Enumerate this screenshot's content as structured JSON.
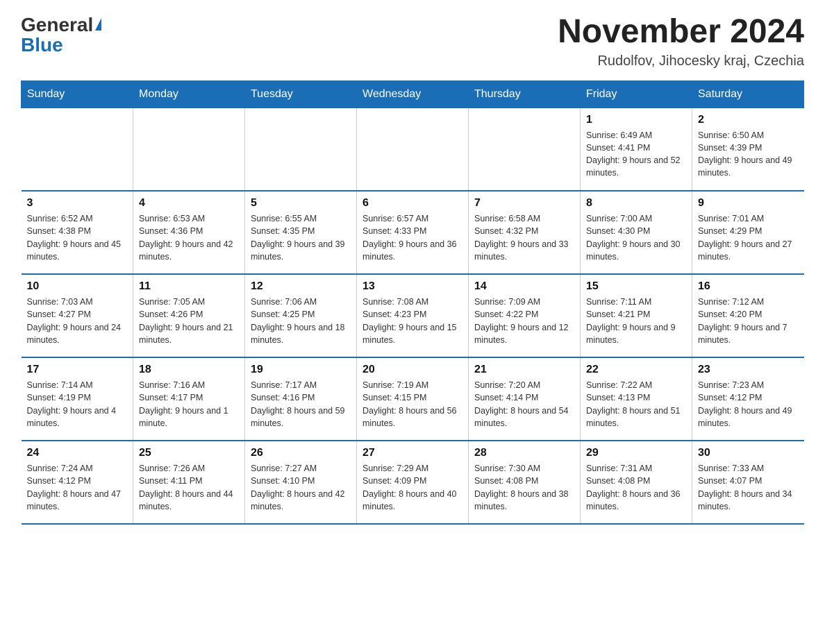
{
  "header": {
    "logo_text_general": "General",
    "logo_text_blue": "Blue",
    "month_title": "November 2024",
    "location": "Rudolfov, Jihocesky kraj, Czechia"
  },
  "days_of_week": [
    "Sunday",
    "Monday",
    "Tuesday",
    "Wednesday",
    "Thursday",
    "Friday",
    "Saturday"
  ],
  "weeks": [
    {
      "days": [
        {
          "number": "",
          "sunrise": "",
          "sunset": "",
          "daylight": ""
        },
        {
          "number": "",
          "sunrise": "",
          "sunset": "",
          "daylight": ""
        },
        {
          "number": "",
          "sunrise": "",
          "sunset": "",
          "daylight": ""
        },
        {
          "number": "",
          "sunrise": "",
          "sunset": "",
          "daylight": ""
        },
        {
          "number": "",
          "sunrise": "",
          "sunset": "",
          "daylight": ""
        },
        {
          "number": "1",
          "sunrise": "Sunrise: 6:49 AM",
          "sunset": "Sunset: 4:41 PM",
          "daylight": "Daylight: 9 hours and 52 minutes."
        },
        {
          "number": "2",
          "sunrise": "Sunrise: 6:50 AM",
          "sunset": "Sunset: 4:39 PM",
          "daylight": "Daylight: 9 hours and 49 minutes."
        }
      ]
    },
    {
      "days": [
        {
          "number": "3",
          "sunrise": "Sunrise: 6:52 AM",
          "sunset": "Sunset: 4:38 PM",
          "daylight": "Daylight: 9 hours and 45 minutes."
        },
        {
          "number": "4",
          "sunrise": "Sunrise: 6:53 AM",
          "sunset": "Sunset: 4:36 PM",
          "daylight": "Daylight: 9 hours and 42 minutes."
        },
        {
          "number": "5",
          "sunrise": "Sunrise: 6:55 AM",
          "sunset": "Sunset: 4:35 PM",
          "daylight": "Daylight: 9 hours and 39 minutes."
        },
        {
          "number": "6",
          "sunrise": "Sunrise: 6:57 AM",
          "sunset": "Sunset: 4:33 PM",
          "daylight": "Daylight: 9 hours and 36 minutes."
        },
        {
          "number": "7",
          "sunrise": "Sunrise: 6:58 AM",
          "sunset": "Sunset: 4:32 PM",
          "daylight": "Daylight: 9 hours and 33 minutes."
        },
        {
          "number": "8",
          "sunrise": "Sunrise: 7:00 AM",
          "sunset": "Sunset: 4:30 PM",
          "daylight": "Daylight: 9 hours and 30 minutes."
        },
        {
          "number": "9",
          "sunrise": "Sunrise: 7:01 AM",
          "sunset": "Sunset: 4:29 PM",
          "daylight": "Daylight: 9 hours and 27 minutes."
        }
      ]
    },
    {
      "days": [
        {
          "number": "10",
          "sunrise": "Sunrise: 7:03 AM",
          "sunset": "Sunset: 4:27 PM",
          "daylight": "Daylight: 9 hours and 24 minutes."
        },
        {
          "number": "11",
          "sunrise": "Sunrise: 7:05 AM",
          "sunset": "Sunset: 4:26 PM",
          "daylight": "Daylight: 9 hours and 21 minutes."
        },
        {
          "number": "12",
          "sunrise": "Sunrise: 7:06 AM",
          "sunset": "Sunset: 4:25 PM",
          "daylight": "Daylight: 9 hours and 18 minutes."
        },
        {
          "number": "13",
          "sunrise": "Sunrise: 7:08 AM",
          "sunset": "Sunset: 4:23 PM",
          "daylight": "Daylight: 9 hours and 15 minutes."
        },
        {
          "number": "14",
          "sunrise": "Sunrise: 7:09 AM",
          "sunset": "Sunset: 4:22 PM",
          "daylight": "Daylight: 9 hours and 12 minutes."
        },
        {
          "number": "15",
          "sunrise": "Sunrise: 7:11 AM",
          "sunset": "Sunset: 4:21 PM",
          "daylight": "Daylight: 9 hours and 9 minutes."
        },
        {
          "number": "16",
          "sunrise": "Sunrise: 7:12 AM",
          "sunset": "Sunset: 4:20 PM",
          "daylight": "Daylight: 9 hours and 7 minutes."
        }
      ]
    },
    {
      "days": [
        {
          "number": "17",
          "sunrise": "Sunrise: 7:14 AM",
          "sunset": "Sunset: 4:19 PM",
          "daylight": "Daylight: 9 hours and 4 minutes."
        },
        {
          "number": "18",
          "sunrise": "Sunrise: 7:16 AM",
          "sunset": "Sunset: 4:17 PM",
          "daylight": "Daylight: 9 hours and 1 minute."
        },
        {
          "number": "19",
          "sunrise": "Sunrise: 7:17 AM",
          "sunset": "Sunset: 4:16 PM",
          "daylight": "Daylight: 8 hours and 59 minutes."
        },
        {
          "number": "20",
          "sunrise": "Sunrise: 7:19 AM",
          "sunset": "Sunset: 4:15 PM",
          "daylight": "Daylight: 8 hours and 56 minutes."
        },
        {
          "number": "21",
          "sunrise": "Sunrise: 7:20 AM",
          "sunset": "Sunset: 4:14 PM",
          "daylight": "Daylight: 8 hours and 54 minutes."
        },
        {
          "number": "22",
          "sunrise": "Sunrise: 7:22 AM",
          "sunset": "Sunset: 4:13 PM",
          "daylight": "Daylight: 8 hours and 51 minutes."
        },
        {
          "number": "23",
          "sunrise": "Sunrise: 7:23 AM",
          "sunset": "Sunset: 4:12 PM",
          "daylight": "Daylight: 8 hours and 49 minutes."
        }
      ]
    },
    {
      "days": [
        {
          "number": "24",
          "sunrise": "Sunrise: 7:24 AM",
          "sunset": "Sunset: 4:12 PM",
          "daylight": "Daylight: 8 hours and 47 minutes."
        },
        {
          "number": "25",
          "sunrise": "Sunrise: 7:26 AM",
          "sunset": "Sunset: 4:11 PM",
          "daylight": "Daylight: 8 hours and 44 minutes."
        },
        {
          "number": "26",
          "sunrise": "Sunrise: 7:27 AM",
          "sunset": "Sunset: 4:10 PM",
          "daylight": "Daylight: 8 hours and 42 minutes."
        },
        {
          "number": "27",
          "sunrise": "Sunrise: 7:29 AM",
          "sunset": "Sunset: 4:09 PM",
          "daylight": "Daylight: 8 hours and 40 minutes."
        },
        {
          "number": "28",
          "sunrise": "Sunrise: 7:30 AM",
          "sunset": "Sunset: 4:08 PM",
          "daylight": "Daylight: 8 hours and 38 minutes."
        },
        {
          "number": "29",
          "sunrise": "Sunrise: 7:31 AM",
          "sunset": "Sunset: 4:08 PM",
          "daylight": "Daylight: 8 hours and 36 minutes."
        },
        {
          "number": "30",
          "sunrise": "Sunrise: 7:33 AM",
          "sunset": "Sunset: 4:07 PM",
          "daylight": "Daylight: 8 hours and 34 minutes."
        }
      ]
    }
  ]
}
